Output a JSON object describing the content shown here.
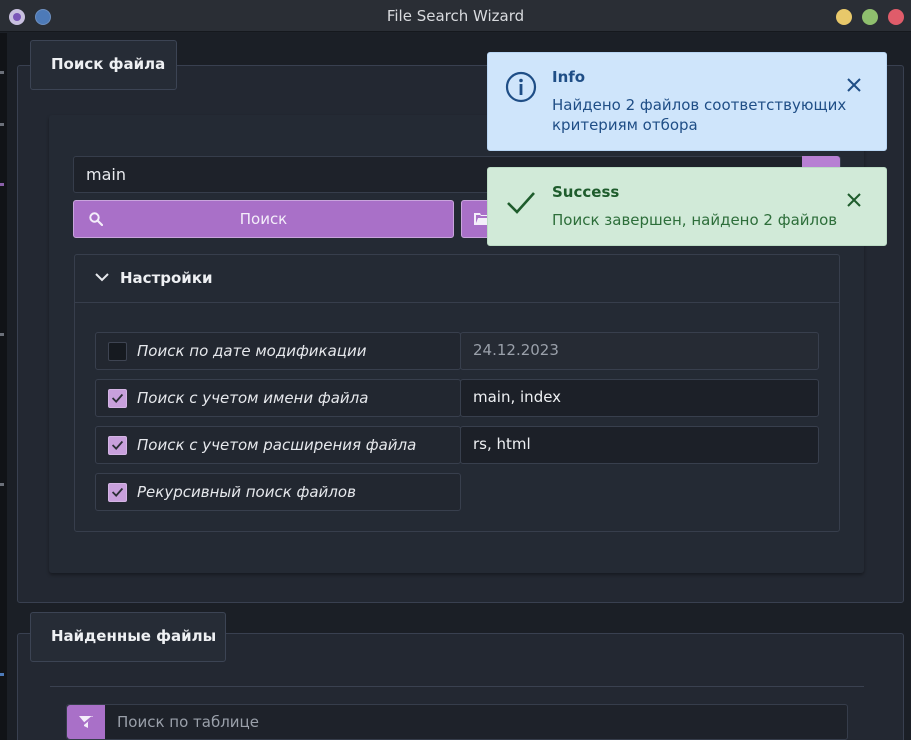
{
  "window": {
    "title": "File Search Wizard"
  },
  "search_section": {
    "tab_label": "Поиск файла",
    "query_value": "main",
    "search_button_label": "Поиск"
  },
  "settings": {
    "header": "Настройки",
    "options": [
      {
        "label": "Поиск по дате модификации",
        "checked": false,
        "value": "24.12.2023"
      },
      {
        "label": "Поиск с учетом имени файла",
        "checked": true,
        "value": "main, index"
      },
      {
        "label": "Поиск с учетом расширения файла",
        "checked": true,
        "value": "rs, html"
      },
      {
        "label": "Рекурсивный поиск файлов",
        "checked": true
      }
    ]
  },
  "found_section": {
    "tab_label": "Найденные файлы",
    "table_search_placeholder": "Поиск по таблице"
  },
  "toasts": {
    "info": {
      "title": "Info",
      "message": "Найдено 2 файлов соответствующих критериям отбора"
    },
    "success": {
      "title": "Success",
      "message": "Поиск завершен, найдено 2 файлов"
    }
  },
  "colors": {
    "accent": "#a970c8",
    "info_bg": "#cfe5fb",
    "success_bg": "#d1ead8"
  }
}
